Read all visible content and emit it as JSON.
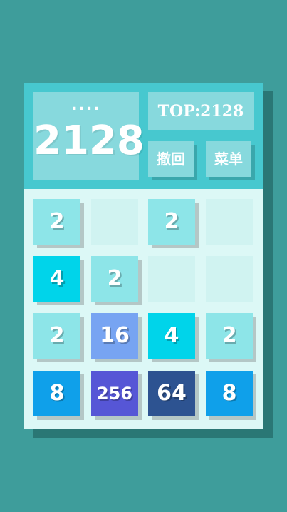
{
  "score": {
    "dots": "....",
    "value": "2128"
  },
  "best": {
    "label": "TOP:2128"
  },
  "buttons": {
    "undo": "撤回",
    "menu": "菜单"
  },
  "board": {
    "rows": [
      [
        "2",
        "",
        "2",
        ""
      ],
      [
        "4",
        "2",
        "",
        ""
      ],
      [
        "2",
        "16",
        "4",
        "2"
      ],
      [
        "8",
        "256",
        "64",
        "8"
      ]
    ]
  },
  "colors": {
    "background": "#3e9d9b",
    "header": "#47c8cf",
    "empty_cell": "#d0f3f1",
    "tile_2": "#8de5e8",
    "tile_4": "#00d4ea",
    "tile_8": "#0fa0ea",
    "tile_16": "#77a4f2",
    "tile_64": "#2d5391",
    "tile_256": "#5656d6"
  }
}
